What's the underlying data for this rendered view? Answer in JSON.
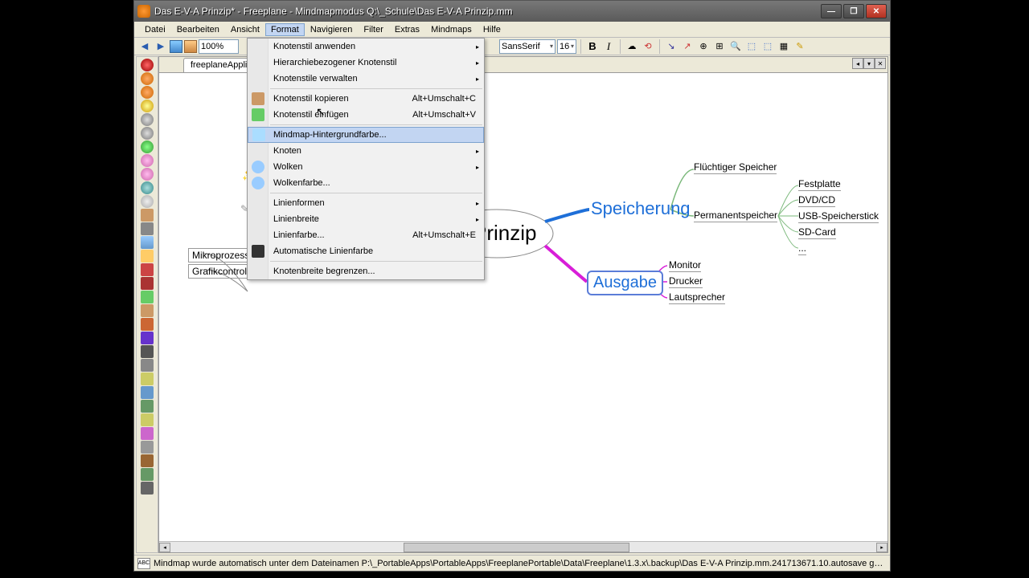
{
  "titlebar": {
    "title": "Das E-V-A Prinzip* - Freeplane - Mindmapmodus Q:\\_Schule\\Das E-V-A Prinzip.mm"
  },
  "winbtns": {
    "min": "—",
    "max": "❐",
    "close": "✕"
  },
  "menubar": {
    "items": [
      "Datei",
      "Bearbeiten",
      "Ansicht",
      "Format",
      "Navigieren",
      "Filter",
      "Extras",
      "Mindmaps",
      "Hilfe"
    ]
  },
  "toolbar": {
    "zoom": "100%",
    "font": "SansSerif",
    "size": "16"
  },
  "tab": {
    "label": "freeplaneApplication"
  },
  "dropdown": {
    "items": [
      {
        "label": "Knotenstil anwenden",
        "submenu": true
      },
      {
        "label": "Hierarchiebezogener Knotenstil",
        "submenu": true
      },
      {
        "label": "Knotenstile verwalten",
        "submenu": true
      },
      {
        "sep": true
      },
      {
        "label": "Knotenstil kopieren",
        "shortcut": "Alt+Umschalt+C",
        "icon": "brush"
      },
      {
        "label": "Knotenstil einfügen",
        "shortcut": "Alt+Umschalt+V",
        "icon": "paint"
      },
      {
        "sep": true
      },
      {
        "label": "Mindmap-Hintergrundfarbe...",
        "hov": true,
        "icon": "page"
      },
      {
        "label": "Knoten",
        "submenu": true
      },
      {
        "label": "Wolken",
        "submenu": true,
        "icon": "cloud"
      },
      {
        "label": "Wolkenfarbe...",
        "icon": "cloudcolor"
      },
      {
        "sep": true
      },
      {
        "label": "Linienformen",
        "submenu": true
      },
      {
        "label": "Linienbreite",
        "submenu": true
      },
      {
        "label": "Linienfarbe...",
        "shortcut": "Alt+Umschalt+E"
      },
      {
        "label": "Automatische Linienfarbe",
        "icon": "autocolor"
      },
      {
        "sep": true
      },
      {
        "label": "Knotenbreite begrenzen..."
      }
    ]
  },
  "mindmap": {
    "root": "Prinzip",
    "speicherung": "Speicherung",
    "ausgabe": "Ausgabe",
    "fluechtiger": "Flüchtiger Speicher",
    "permanent": "Permanentspeicher",
    "perm_items": [
      "Festplatte",
      "DVD/CD",
      "USB-Speicherstick",
      "SD-Card",
      "..."
    ],
    "ausgabe_items": [
      "Monitor",
      "Drucker",
      "Lautsprecher"
    ],
    "left_items": [
      "Mikroprozessor",
      "Grafikcontroller"
    ]
  },
  "status": {
    "text": "Mindmap wurde automatisch unter dem Dateinamen P:\\_PortableApps\\PortableApps\\FreeplanePortable\\Data\\Freeplane\\1.3.x\\.backup\\Das E-V-A Prinzip.mm.241713671.10.autosave gespeichert…",
    "abc": "ABC"
  }
}
